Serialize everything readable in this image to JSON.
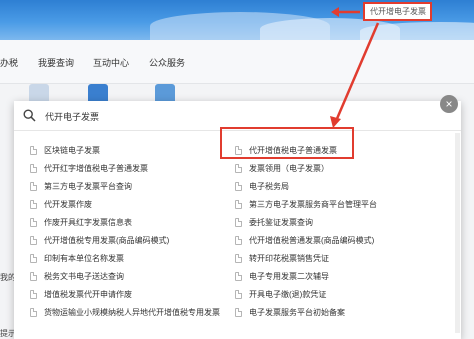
{
  "banner": {
    "search_text": "代开增电子发票"
  },
  "nav": {
    "items": [
      {
        "label": "办税"
      },
      {
        "label": "我要查询"
      },
      {
        "label": "互动中心"
      },
      {
        "label": "公众服务"
      }
    ]
  },
  "background_edge": {
    "text1": "我的",
    "text2": "提示"
  },
  "popup": {
    "query": "代开电子发票",
    "close_label": "×",
    "left_results": [
      "区块链电子发票",
      "代开红字增值税电子普通发票",
      "第三方电子发票平台查询",
      "代开发票作废",
      "作废开具红字发票信息表",
      "代开增值税专用发票(商品编码模式)",
      "印制有本单位名称发票",
      "税务文书电子送达查询",
      "增值税发票代开申请作废",
      "货物运输业小规模纳税人异地代开增值税专用发票"
    ],
    "right_results": [
      "代开增值税电子普通发票",
      "发票领用（电子发票）",
      "电子税务局",
      "第三方电子发票服务商平台管理平台",
      "委托鉴证发票查询",
      "代开增值税普通发票(商品编码模式)",
      "转开印花税票销售凭证",
      "电子专用发票二次辅导",
      "开具电子缴(退)款凭证",
      "电子发票服务平台初始备案"
    ]
  },
  "colors": {
    "highlight": "#e13c2f",
    "banner": "#3f8fdc"
  }
}
